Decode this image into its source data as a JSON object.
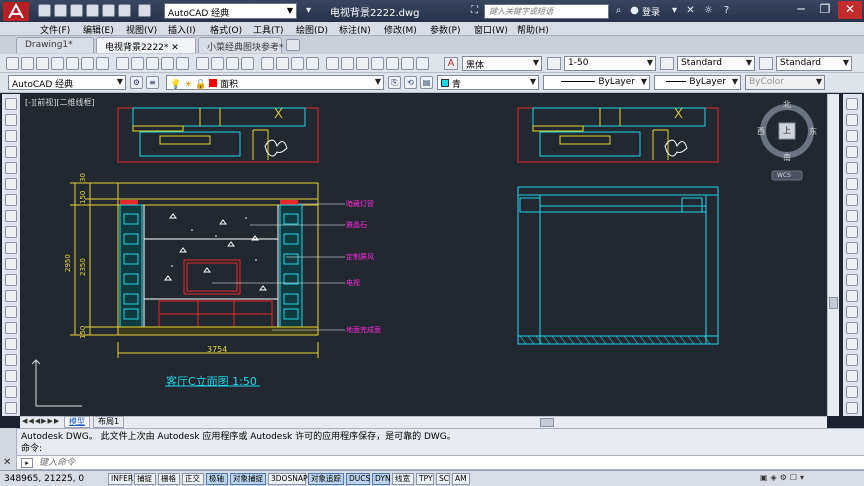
{
  "window": {
    "file_title": "电视背景2222.dwg",
    "workspace": "AutoCAD 经典",
    "search_placeholder": "键入关键字或短语",
    "login": "登录",
    "min": "─",
    "max": "❐",
    "close": "✕"
  },
  "menu": [
    "文件(F)",
    "编辑(E)",
    "视图(V)",
    "插入(I)",
    "格式(O)",
    "工具(T)",
    "绘图(D)",
    "标注(N)",
    "修改(M)",
    "参数(P)",
    "窗口(W)",
    "帮助(H)"
  ],
  "tabs": [
    "Drawing1*",
    "电视背景2222*",
    "小菜经典图块参考*"
  ],
  "toolbar2": {
    "text_style": "黑体",
    "scale": "1-50",
    "dim_style": "Standard",
    "table_style": "Standard"
  },
  "toolbar3": {
    "workspace": "AutoCAD 经典",
    "layer": "面积",
    "color": "青",
    "linetype": "ByLayer",
    "lineweight": "ByLayer",
    "plotstyle": "ByColor"
  },
  "viewport_label": "[-][前视][二维线框]",
  "viewcube": {
    "north": "北",
    "south": "南",
    "east": "东",
    "west": "西",
    "center": "上",
    "wcs": "WCS"
  },
  "drawing": {
    "labels": [
      "暗藏灯管",
      "雅晶石",
      "定制屏风",
      "电视",
      "地面完成面"
    ],
    "dims_left": [
      "30",
      "150",
      "2950",
      "2350",
      "150"
    ],
    "dim_bottom": "3754",
    "title": "客厅C立面图 1:50"
  },
  "layout_tabs": [
    "模型",
    "布局1"
  ],
  "command": {
    "history_line": "Autodesk DWG。  此文件上次由 Autodesk 应用程序或 Autodesk 许可的应用程序保存，是可靠的 DWG。",
    "prompt": "命令:",
    "input_placeholder": "键入命令"
  },
  "status": {
    "coords": "348965, 21225, 0",
    "buttons": [
      "INFER",
      "捕捉",
      "栅格",
      "正交",
      "极轴",
      "对象捕捉",
      "3DOSNAP",
      "对象追踪",
      "DUCS",
      "DYN",
      "线宽",
      "TPY",
      "SC",
      "AM"
    ],
    "on": [
      "极轴",
      "对象捕捉",
      "对象追踪",
      "DUCS",
      "DYN"
    ]
  },
  "colors": {
    "title_bg": "#2c3650",
    "canvas_bg": "#212830",
    "red": "#e8262b",
    "cyan": "#1ed6e8",
    "yellow": "#e6d630",
    "magenta": "#ff2ad8",
    "white": "#ffffff"
  }
}
